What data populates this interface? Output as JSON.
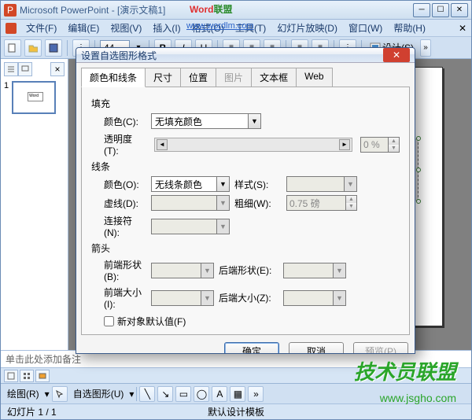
{
  "window_title": "Microsoft PowerPoint - [演示文稿1]",
  "overlay_brand": {
    "part1": "Word",
    "part2": "联盟"
  },
  "overlay_url": "www.wordlm.com",
  "menu": [
    "文件(F)",
    "编辑(E)",
    "视图(V)",
    "插入(I)",
    "格式(O)",
    "工具(T)",
    "幻灯片放映(D)",
    "窗口(W)",
    "帮助(H)"
  ],
  "font_size_value": "44",
  "design_label": "设计(S)",
  "thumb_number": "1",
  "thumb_tiny_text": "Word",
  "notes_placeholder": "单击此处添加备注",
  "drawbar": {
    "draw": "绘图(R)",
    "autoshape": "自选图形(U)"
  },
  "status": {
    "slide": "幻灯片 1 / 1",
    "template": "默认设计模板"
  },
  "dialog": {
    "title": "设置自选图形格式",
    "tabs": [
      "颜色和线条",
      "尺寸",
      "位置",
      "图片",
      "文本框",
      "Web"
    ],
    "fill_section": "填充",
    "fill_color_label": "颜色(C):",
    "fill_color_value": "无填充颜色",
    "transparency_label": "透明度(T):",
    "transparency_value": "0 %",
    "line_section": "线条",
    "line_color_label": "颜色(O):",
    "line_color_value": "无线条颜色",
    "line_style_label": "样式(S):",
    "dash_label": "虚线(D):",
    "weight_label": "粗细(W):",
    "weight_value": "0.75 磅",
    "connector_label": "连接符(N):",
    "arrow_section": "箭头",
    "begin_shape_label": "前端形状(B):",
    "end_shape_label": "后端形状(E):",
    "begin_size_label": "前端大小(I):",
    "end_size_label": "后端大小(Z):",
    "default_new_label": "新对象默认值(F)",
    "ok": "确定",
    "cancel": "取消",
    "preview": "预览(P)"
  },
  "watermark1": "技术员联盟",
  "watermark2": "www.jsgho.com"
}
